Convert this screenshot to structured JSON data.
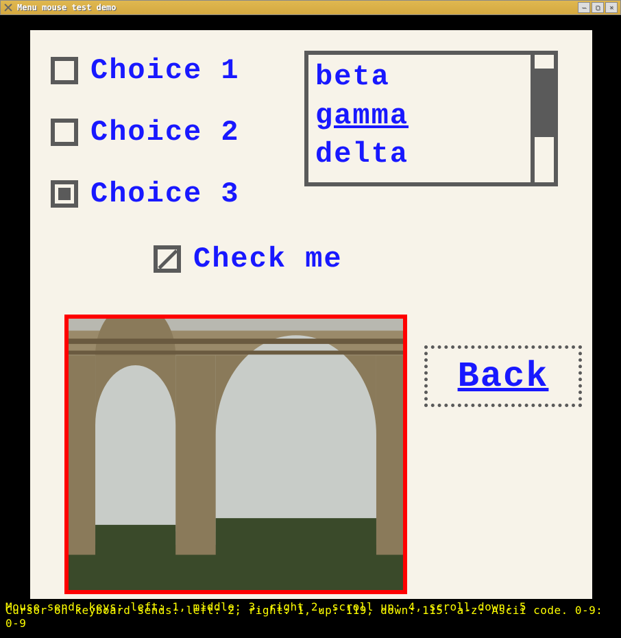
{
  "window": {
    "title": "Menu mouse test demo"
  },
  "choices": {
    "c1": "Choice 1",
    "c2": "Choice 2",
    "c3": "Choice 3",
    "selected_index": 2
  },
  "checkbox": {
    "label": "Check me",
    "checked": true
  },
  "listbox": {
    "items": [
      "beta",
      "gamma",
      "delta"
    ],
    "selected_index": 1
  },
  "back_button": "Back",
  "status_line_1": "Mouse sends keys: left: 1, middle: 3, right 2, scroll up: 4, scroll down: 5",
  "status_line_2": "Cursor on keyboard sends: left: 2, right: 1, up: 119, down: 115. a-z: Ascii code. 0-9: 0-9"
}
